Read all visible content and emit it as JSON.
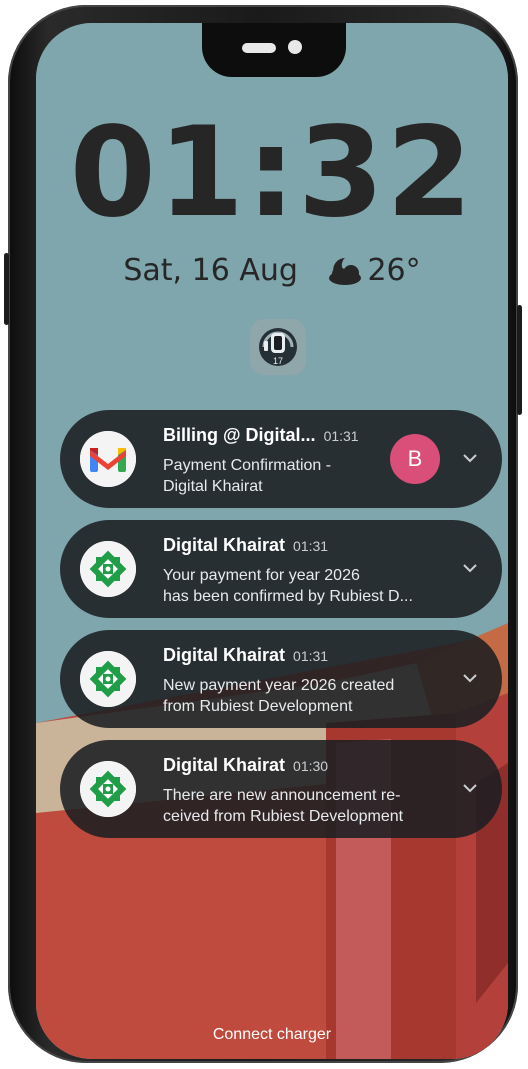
{
  "status": {
    "time": "01:32",
    "date": "Sat, 16 Aug",
    "weather_icon": "moon-cloud-icon",
    "temperature": "26°"
  },
  "aod_badge": {
    "icon": "watch-icon",
    "count": "17"
  },
  "notifications": [
    {
      "app_icon": "gmail-icon",
      "title": "Billing @ Digital...",
      "time": "01:31",
      "body": "Payment Confirmation -\nDigital Khairat",
      "avatar_letter": "B",
      "avatar_color": "#d94f79"
    },
    {
      "app_icon": "digital-khairat-icon",
      "title": "Digital Khairat",
      "time": "01:31",
      "body": "Your payment for year 2026\nhas been confirmed by Rubiest D..."
    },
    {
      "app_icon": "digital-khairat-icon",
      "title": "Digital Khairat",
      "time": "01:31",
      "body": "New payment year 2026 created\nfrom Rubiest Development"
    },
    {
      "app_icon": "digital-khairat-icon",
      "title": "Digital Khairat",
      "time": "01:30",
      "body": "There are new announcement re-\nceived from Rubiest Development"
    }
  ],
  "footer": {
    "hint": "Connect charger"
  },
  "colors": {
    "wallpaper_sky": "#7fa5ad",
    "wallpaper_red": "#c0463c",
    "card_bg": "#1c1f22",
    "khairat_green": "#1f9d47"
  }
}
